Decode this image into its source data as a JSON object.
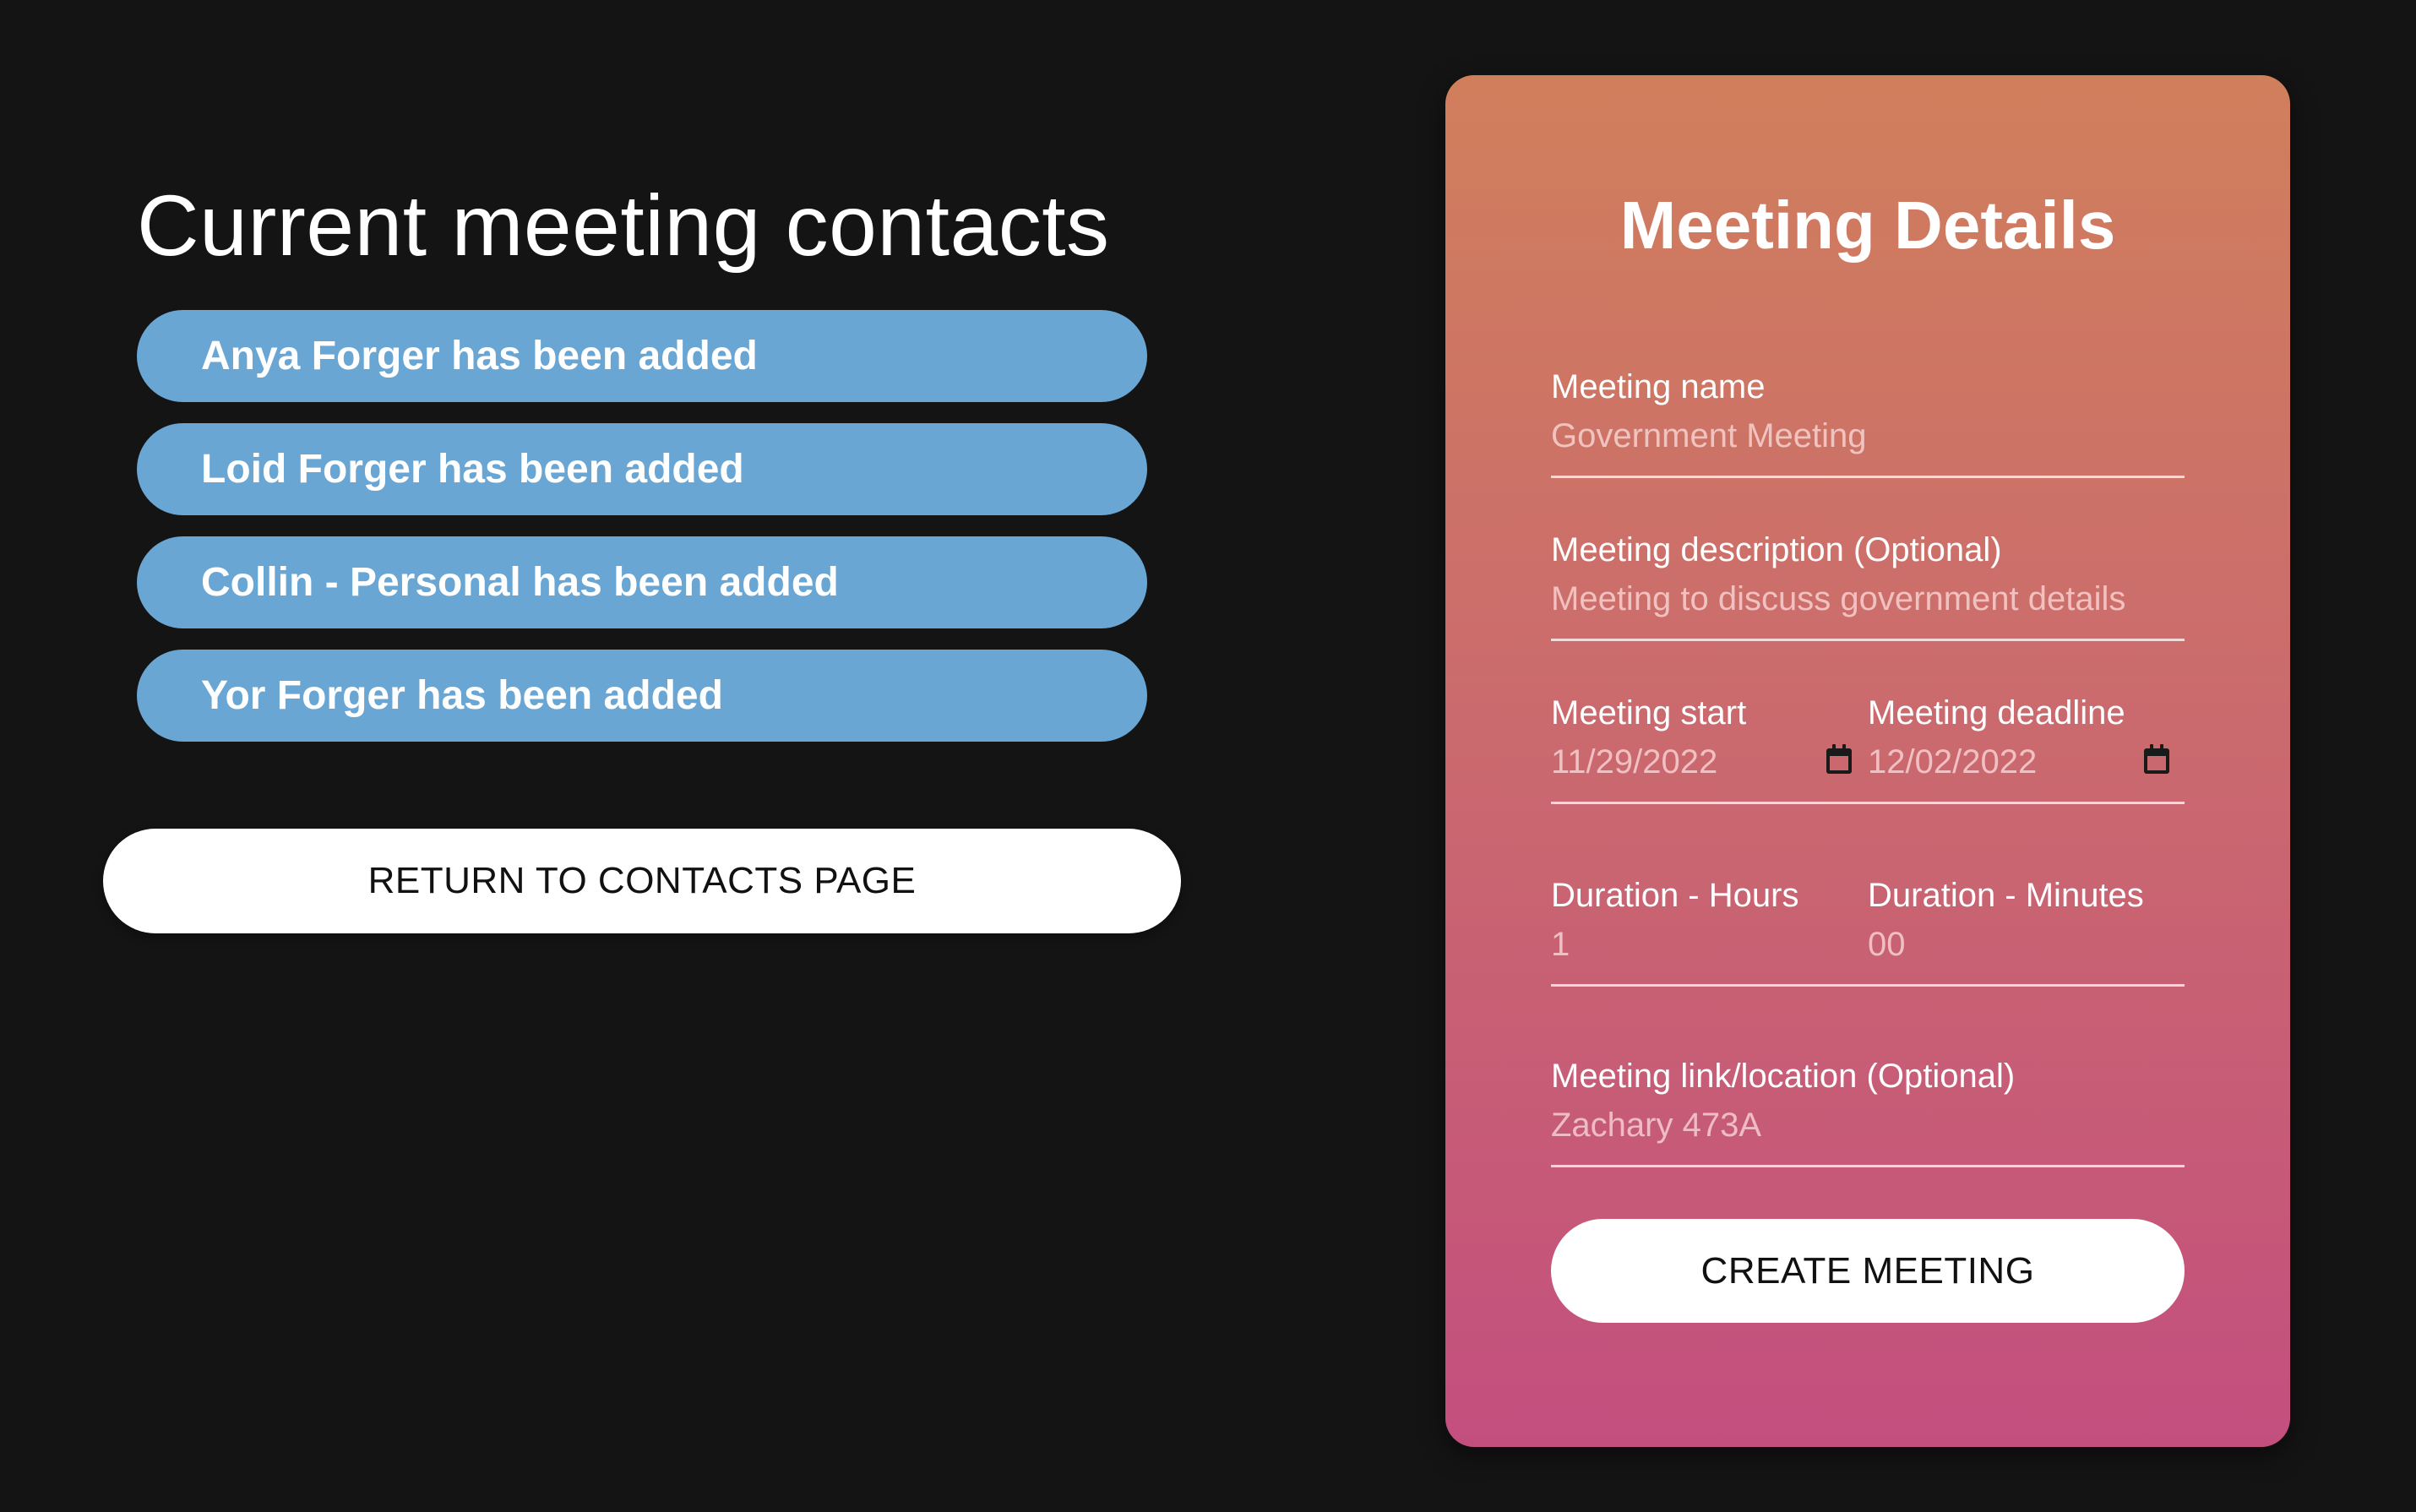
{
  "contacts": {
    "title": "Current meeting contacts",
    "items": [
      {
        "label": "Anya Forger has been added"
      },
      {
        "label": "Loid Forger has been added"
      },
      {
        "label": "Collin - Personal has been added"
      },
      {
        "label": "Yor Forger has been added"
      }
    ],
    "return_button": "RETURN TO CONTACTS PAGE"
  },
  "meeting": {
    "title": "Meeting Details",
    "name": {
      "label": "Meeting name",
      "value": "Government Meeting"
    },
    "description": {
      "label": "Meeting description (Optional)",
      "value": "Meeting to discuss government details"
    },
    "start": {
      "label": "Meeting start",
      "value": "11/29/2022",
      "icon": "calendar-icon"
    },
    "deadline": {
      "label": "Meeting deadline",
      "value": "12/02/2022",
      "icon": "calendar-icon"
    },
    "duration_hours": {
      "label": "Duration - Hours",
      "value": "1"
    },
    "duration_minutes": {
      "label": "Duration - Minutes",
      "value": "00"
    },
    "location": {
      "label": "Meeting link/location (Optional)",
      "value": "Zachary 473A"
    },
    "create_button": "CREATE MEETING"
  },
  "colors": {
    "background": "#141414",
    "contact_pill": "#6aa6d3",
    "card_gradient_top": "#d07f5c",
    "card_gradient_bottom": "#c34f7e",
    "button": "#ffffff"
  }
}
